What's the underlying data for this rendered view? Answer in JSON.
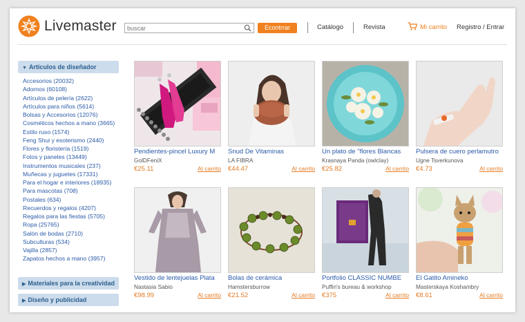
{
  "brand": {
    "name": "Livemaster"
  },
  "search": {
    "placeholder": "buscar",
    "button": "Econtrrar"
  },
  "nav": {
    "catalog": "Catálogo",
    "magazine": "Revista",
    "cart": "Mi carrito",
    "login": "Registro / Entrar"
  },
  "sidebar": {
    "designer_heading": "Artículos de diseñador",
    "categories": [
      "Accesorios (20032)",
      "Adornos (60108)",
      "Artículos de pelería (2622)",
      "Artículos para niños (5614)",
      "Bolsas y Accesorios (12076)",
      "Cosméticos hechos a mano (3665)",
      "Estilo ruso (1574)",
      "Feng Shui y esoterismo (2440)",
      "Flores y floristería (1519)",
      "Fotos y paneles (13449)",
      "Instrumentos musicales (237)",
      "Muñecas y juguetes (17331)",
      "Para el hogar e interiores (18935)",
      "Para mascotas (708)",
      "Postales (634)",
      "Recuerdos y regalos (4207)",
      "Regalos para las fiestas (5705)",
      "Ropa (25765)",
      "Salón de bodas (2710)",
      "Subculturas (534)",
      "Vajilla (2857)",
      "Zapatos hechos a mano (3957)"
    ],
    "materials_heading": "Materiales para la creatividad",
    "design_heading": "Diseño y publicidad"
  },
  "products": [
    {
      "title": "Pendientes-pincel Luxury M",
      "seller": "GolDFeniX",
      "price": "€25.11",
      "cart": "Al carrito"
    },
    {
      "title": "Snud De Vitaminas",
      "seller": "LA FIBRA",
      "price": "€44.47",
      "cart": "Al carrito"
    },
    {
      "title": "Un plato de \"flores Blancas",
      "seller": "Krasnaya Panda (owlclay)",
      "price": "€25.82",
      "cart": "Al carrito"
    },
    {
      "title": "Pulsera de cuero perlamutro",
      "seller": "Ugne Tsverkunova",
      "price": "€4.73",
      "cart": "Al carrito"
    },
    {
      "title": "Vestido de lentejuelas Plata",
      "seller": "Nastasia Sabio",
      "price": "€98.99",
      "cart": "Al carrito"
    },
    {
      "title": "Bolas de cerámica",
      "seller": "Hamstersburrow",
      "price": "€21.52",
      "cart": "Al carrito"
    },
    {
      "title": "Portfolio CLASSIC NUMBE",
      "seller": "Puffin's bureau & workshop",
      "price": "€375",
      "cart": "Al carrito"
    },
    {
      "title": "El Gatito Amineko",
      "seller": "Masterskaya Koshambry",
      "price": "€8.61",
      "cart": "Al carrito"
    }
  ],
  "colors": {
    "accent": "#f0811f",
    "link": "#2a5aa8",
    "sidebar_heading_bg": "#ccdcec"
  }
}
